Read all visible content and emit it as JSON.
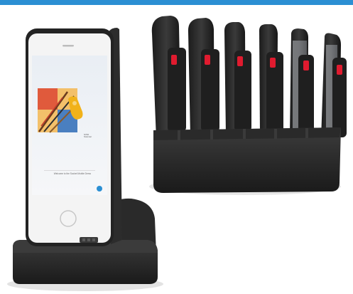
{
  "scene": {
    "accent_color": "#2b8fd3",
    "phone_screen": {
      "caption": "Welcome to the Socket Mobile Demo",
      "product_label": "S700 Scanner"
    },
    "single_dock": {
      "description_color": "#2c2c2c"
    },
    "multi_dock": {
      "slots": 6,
      "indicator_color": "#e01b2f"
    }
  }
}
